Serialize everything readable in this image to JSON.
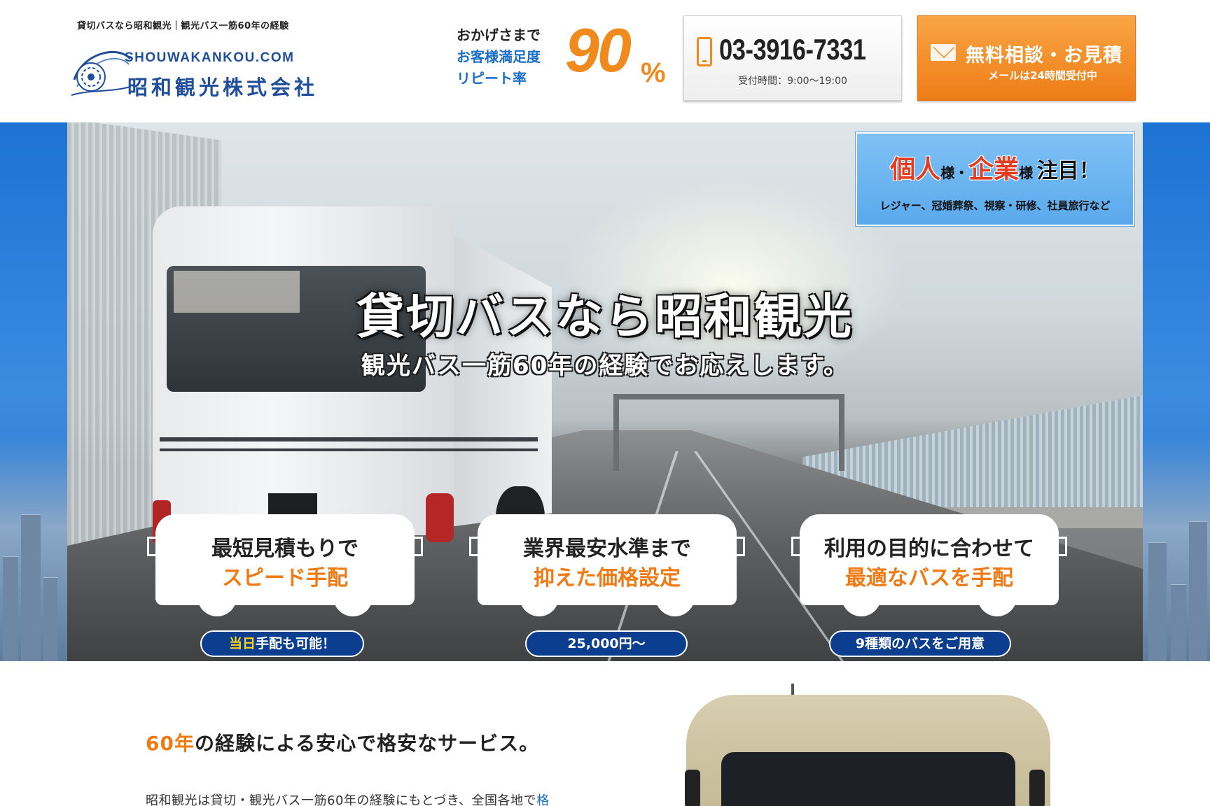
{
  "header": {
    "tagline": "貸切バスなら昭和観光｜観光バス一筋60年の経験",
    "logo_domain": "SHOUWAKANKOU.COM",
    "logo_name": "昭和観光株式会社",
    "satisfaction": {
      "line1": "おかげさまで",
      "line2": "お客様満足度",
      "line3": "リピート率",
      "number": "90",
      "unit": "%"
    },
    "phone": {
      "number": "03-3916-7331",
      "hours": "受付時間：9:00〜19:00"
    },
    "contact": {
      "title": "無料相談・お見積",
      "sub": "メールは24時間受付中"
    }
  },
  "hero": {
    "title": "貸切バスなら昭和観光",
    "subtitle": "観光バス一筋60年の経験でお応えします。",
    "target": {
      "word1": "個人",
      "suffix1": "様",
      "sep": "・",
      "word2": "企業",
      "suffix2": "様",
      "attention": "注目！",
      "sub": "レジャー、冠婚葬祭、視察・研修、社員旅行など"
    },
    "features": [
      {
        "line1": "最短見積もりで",
        "line2": "スピード手配",
        "pill_accent": "当日",
        "pill_rest": "手配も可能！"
      },
      {
        "line1": "業界最安水準まで",
        "line2": "抑えた価格設定",
        "pill_accent": "",
        "pill_rest": "25,000円〜"
      },
      {
        "line1": "利用の目的に合わせて",
        "line2": "最適なバスを手配",
        "pill_accent": "",
        "pill_rest": "9種類のバスをご用意"
      }
    ]
  },
  "intro": {
    "title_accent": "60年",
    "title_rest": "の経験による安心で格安なサービス。",
    "text": "昭和観光は貸切・観光バス一筋60年の経験にもとづき、全国各地で",
    "text_link": "格"
  },
  "colors": {
    "brand_blue": "#1f4e9c",
    "accent_orange": "#f08a1d",
    "pill_navy": "#0b3e8f"
  },
  "icons": {
    "phone": "smartphone-icon",
    "mail": "envelope-icon"
  }
}
